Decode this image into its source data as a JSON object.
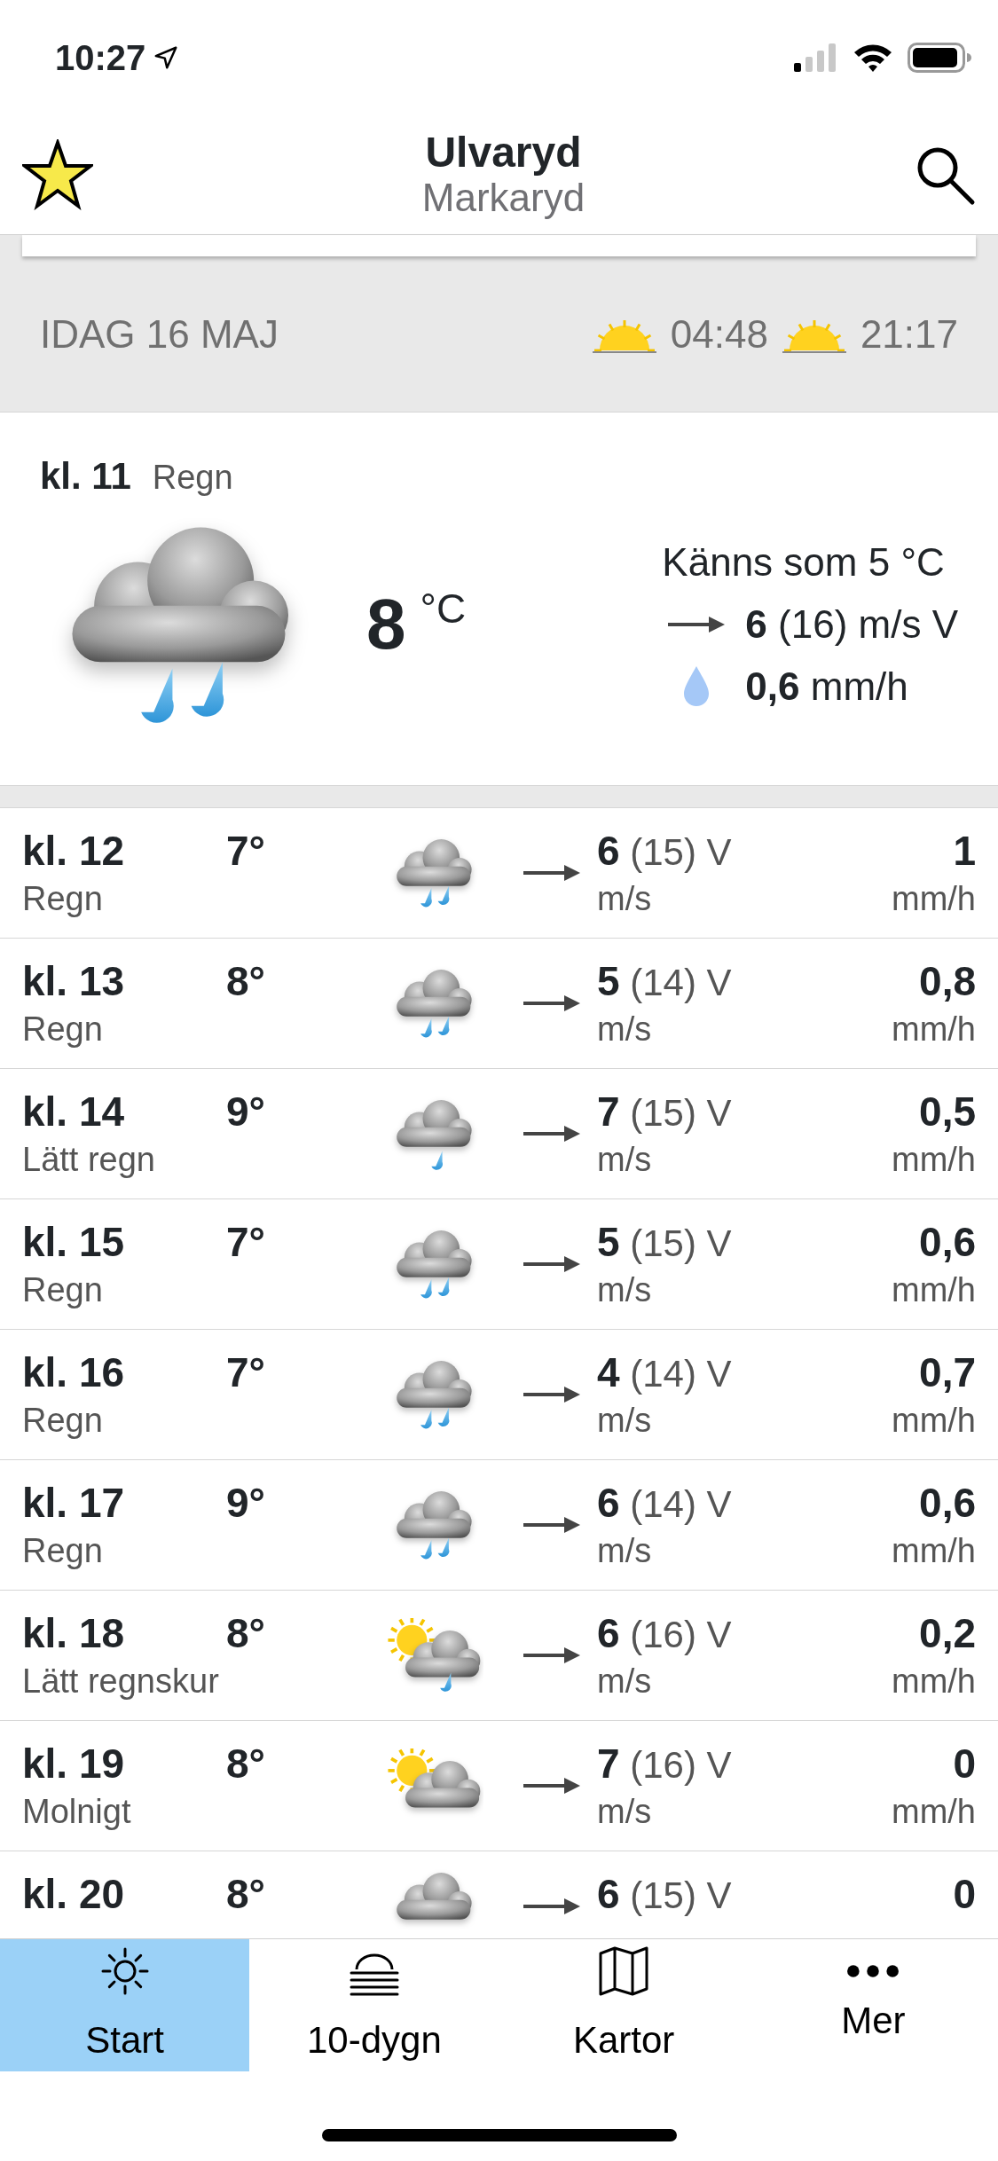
{
  "status_bar": {
    "time": "10:27"
  },
  "header": {
    "title": "Ulvaryd",
    "subtitle": "Markaryd",
    "favorite": true
  },
  "day": {
    "label": "IDAG 16 MAJ",
    "sunrise": "04:48",
    "sunset": "21:17"
  },
  "current": {
    "hour": "kl. 11",
    "desc": "Regn",
    "kind": "rain",
    "temp": "8",
    "unit": "°C",
    "feels": "Känns som 5 °C",
    "wind": "6",
    "gust": "(16) m/s V",
    "precip": "0,6",
    "precip_unit": "mm/h"
  },
  "hours": [
    {
      "hour": "kl. 12",
      "temp": "7°",
      "desc": "Regn",
      "kind": "rain",
      "wind": "6",
      "gust": "(15) V",
      "wind_unit": "m/s",
      "precip": "1",
      "precip_unit": "mm/h"
    },
    {
      "hour": "kl. 13",
      "temp": "8°",
      "desc": "Regn",
      "kind": "rain",
      "wind": "5",
      "gust": "(14) V",
      "wind_unit": "m/s",
      "precip": "0,8",
      "precip_unit": "mm/h"
    },
    {
      "hour": "kl. 14",
      "temp": "9°",
      "desc": "Lätt regn",
      "kind": "light-rain",
      "wind": "7",
      "gust": "(15) V",
      "wind_unit": "m/s",
      "precip": "0,5",
      "precip_unit": "mm/h"
    },
    {
      "hour": "kl. 15",
      "temp": "7°",
      "desc": "Regn",
      "kind": "rain",
      "wind": "5",
      "gust": "(15) V",
      "wind_unit": "m/s",
      "precip": "0,6",
      "precip_unit": "mm/h"
    },
    {
      "hour": "kl. 16",
      "temp": "7°",
      "desc": "Regn",
      "kind": "rain",
      "wind": "4",
      "gust": "(14) V",
      "wind_unit": "m/s",
      "precip": "0,7",
      "precip_unit": "mm/h"
    },
    {
      "hour": "kl. 17",
      "temp": "9°",
      "desc": "Regn",
      "kind": "rain",
      "wind": "6",
      "gust": "(14) V",
      "wind_unit": "m/s",
      "precip": "0,6",
      "precip_unit": "mm/h"
    },
    {
      "hour": "kl. 18",
      "temp": "8°",
      "desc": "Lätt regnskur",
      "kind": "sun-rain",
      "wind": "6",
      "gust": "(16) V",
      "wind_unit": "m/s",
      "precip": "0,2",
      "precip_unit": "mm/h"
    },
    {
      "hour": "kl. 19",
      "temp": "8°",
      "desc": "Molnigt",
      "kind": "sun-cloud",
      "wind": "7",
      "gust": "(16) V",
      "wind_unit": "m/s",
      "precip": "0",
      "precip_unit": "mm/h"
    },
    {
      "hour": "kl. 20",
      "temp": "8°",
      "kind": "cloud",
      "wind": "6",
      "gust": "(15) V",
      "precip": "0"
    }
  ],
  "tabs": [
    {
      "label": "Start",
      "kind": "sun",
      "selected": true
    },
    {
      "label": "10-dygn",
      "kind": "fog",
      "selected": false
    },
    {
      "label": "Kartor",
      "kind": "map",
      "selected": false
    },
    {
      "label": "Mer",
      "kind": "dots",
      "selected": false
    }
  ]
}
